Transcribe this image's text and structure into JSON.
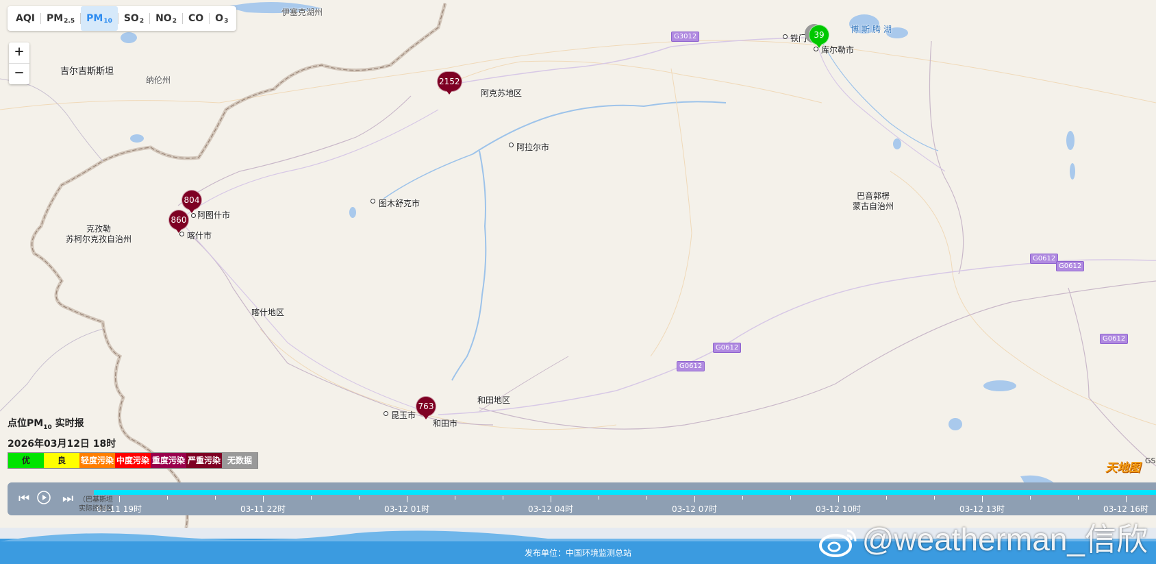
{
  "pollutant_tabs": [
    {
      "name": "AQI",
      "sub": ""
    },
    {
      "name": "PM",
      "sub": "2.5"
    },
    {
      "name": "PM",
      "sub": "10",
      "active": true
    },
    {
      "name": "SO",
      "sub": "2"
    },
    {
      "name": "NO",
      "sub": "2"
    },
    {
      "name": "CO",
      "sub": ""
    },
    {
      "name": "O",
      "sub": "3"
    }
  ],
  "zoom": {
    "in": "+",
    "out": "−"
  },
  "map_labels": {
    "yisaike": "伊塞克湖州",
    "kyrgyzstan": "吉尔吉斯斯坦",
    "naryn": "纳伦州",
    "aksu_region": "阿克苏地区",
    "alaer": "阿拉尔市",
    "tumxuk": "图木舒克市",
    "artux": "阿图什市",
    "kashgar_city": "喀什市",
    "kizilsu_1": "克孜勒",
    "kizilsu_2": "苏柯尔克孜自治州",
    "kashgar_region": "喀什地区",
    "kunyu": "昆玉市",
    "hotan_city": "和田市",
    "hotan_region": "和田地区",
    "bayingol_1": "巴音郭楞",
    "bayingol_2": "蒙古自治州",
    "tiemen": "铁门",
    "korla": "库尔勒市",
    "bosten": "博斯腾湖",
    "pakistan_note_1": "（巴基斯坦",
    "pakistan_note_2": "实际控制区"
  },
  "road_shields": [
    "G3012",
    "G0612",
    "G0612",
    "G0612",
    "G0612",
    "G0612"
  ],
  "markers": [
    {
      "value": "2152",
      "level": "severe",
      "color": "#7e0023"
    },
    {
      "value": "804",
      "level": "severe",
      "color": "#7e0023"
    },
    {
      "value": "860",
      "level": "severe",
      "color": "#7e0023"
    },
    {
      "value": "763",
      "level": "severe",
      "color": "#7e0023"
    },
    {
      "value": "39",
      "level": "excellent",
      "color": "#00c800"
    }
  ],
  "legend": {
    "title_prefix": "点位PM",
    "title_sub": "10",
    "title_suffix": " 实时报",
    "time": "2026年03月12日 18时",
    "levels": [
      {
        "label": "优",
        "color": "#00e400",
        "text_color": "#222"
      },
      {
        "label": "良",
        "color": "#ffff00",
        "text_color": "#222"
      },
      {
        "label": "轻度污染",
        "color": "#ff7e00",
        "text_color": "#fff"
      },
      {
        "label": "中度污染",
        "color": "#ff0000",
        "text_color": "#fff"
      },
      {
        "label": "重度污染",
        "color": "#99004c",
        "text_color": "#fff"
      },
      {
        "label": "严重污染",
        "color": "#7e0023",
        "text_color": "#fff"
      },
      {
        "label": "无数据",
        "color": "#999999",
        "text_color": "#fff"
      }
    ]
  },
  "timeline": {
    "labels": [
      "03-11 19时",
      "03-11 22时",
      "03-12 01时",
      "03-12 04时",
      "03-12 07时",
      "03-12 10时",
      "03-12 13时",
      "03-12 16时"
    ]
  },
  "footer": {
    "publisher": "发布单位：中国环境监测总站",
    "watermark": "@weatherman_信欣"
  },
  "branding": {
    "tianditu": "天地图",
    "gs": "GS"
  }
}
